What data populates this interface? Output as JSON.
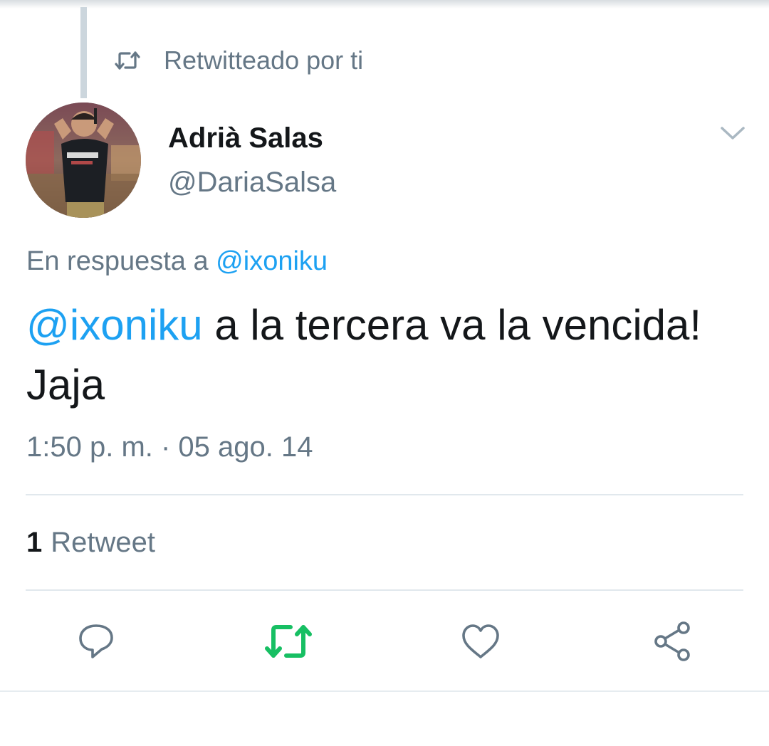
{
  "context": {
    "retweeted_label": "Retwitteado por ti"
  },
  "author": {
    "display_name": "Adrià Salas",
    "handle": "@DariaSalsa"
  },
  "reply": {
    "prefix": "En respuesta a",
    "mention": "@ixoniku"
  },
  "tweet": {
    "mention": "@ixoniku",
    "text": " a la tercera va la vencida! Jaja",
    "timestamp": "1:50 p. m. · 05 ago. 14"
  },
  "stats": {
    "retweet_count": "1",
    "retweet_label": "Retweet"
  },
  "actions": [
    {
      "name": "reply",
      "icon": "comment-icon"
    },
    {
      "name": "retweet",
      "icon": "retweet-icon",
      "active": true
    },
    {
      "name": "like",
      "icon": "heart-icon"
    },
    {
      "name": "share",
      "icon": "share-icon"
    }
  ],
  "colors": {
    "accent": "#1da1f2",
    "retweet_active": "#17bf63",
    "secondary_text": "#657786",
    "primary_text": "#14171a",
    "divider": "#e1e8ed"
  }
}
